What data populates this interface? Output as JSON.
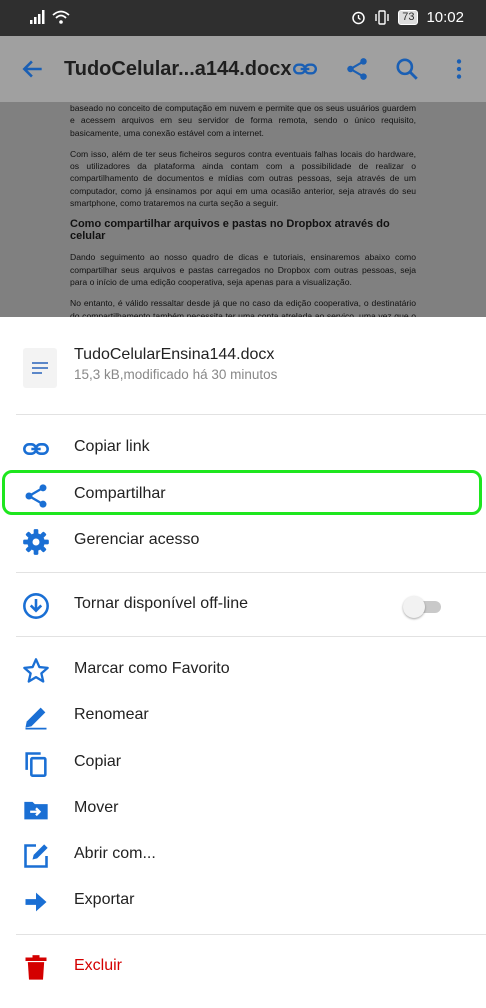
{
  "status_bar": {
    "battery": "73",
    "time": "10:02"
  },
  "toolbar": {
    "title": "TudoCelular...a144.docx"
  },
  "document": {
    "paragraphs": [
      "baseado no conceito de computação em nuvem e permite que os seus usuários guardem e acessem arquivos em seu servidor de forma remota, sendo o único requisito, basicamente, uma conexão estável com a internet.",
      "Com isso, além de ter seus ficheiros seguros contra eventuais falhas locais do hardware, os utilizadores da plataforma ainda contam com a possibilidade de realizar o compartilhamento de documentos e mídias com outras pessoas, seja através de um computador, como já ensinamos por aqui em uma ocasião anterior, seja através do seu smartphone, como trataremos na curta seção a seguir."
    ],
    "heading": "Como compartilhar arquivos e pastas no Dropbox através do celular",
    "paragraphs2": [
      "Dando seguimento ao nosso quadro de dicas e tutoriais, ensinaremos abaixo como compartilhar seus arquivos e pastas carregados no Dropbox com outras pessoas, seja para o início de uma edição cooperativa, seja apenas para a visualização.",
      "No entanto, é válido ressaltar desde já que no caso da edição cooperativa, o destinatário do compartilhamento também necessita ter uma conta atrelada ao serviço, uma vez que o arquivo compartilhado será copiado para a sua própria conta do Dropbox e, como já era de se imaginar, ocupará parte do seu armazenamento livre."
    ]
  },
  "file": {
    "name": "TudoCelularEnsina144.docx",
    "meta": "15,3 kB,modificado há 30 minutos"
  },
  "menu": {
    "copy_link": "Copiar link",
    "share": "Compartilhar",
    "manage_access": "Gerenciar acesso",
    "offline": "Tornar disponível off-line",
    "offline_enabled": false,
    "favorite": "Marcar como Favorito",
    "rename": "Renomear",
    "copy": "Copiar",
    "move": "Mover",
    "open_with": "Abrir com...",
    "export": "Exportar",
    "delete": "Excluir"
  },
  "colors": {
    "accent": "#1a6fd4",
    "danger": "#d40000",
    "highlight": "#1ee61e"
  }
}
